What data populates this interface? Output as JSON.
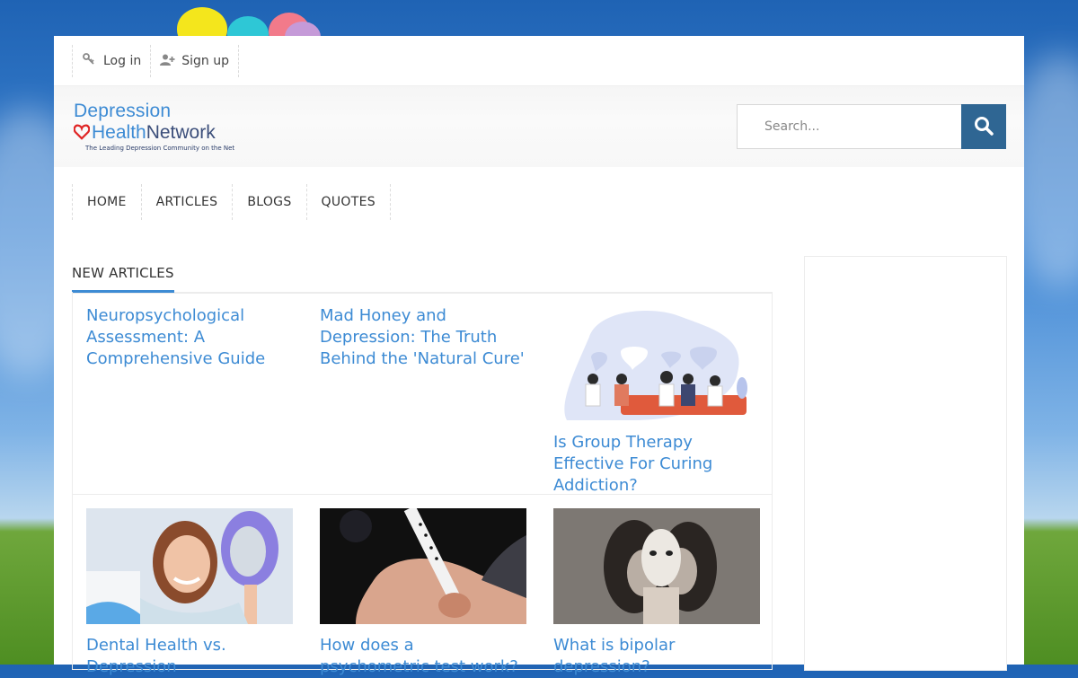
{
  "topbar": {
    "login_label": "Log in",
    "signup_label": "Sign up"
  },
  "logo": {
    "line1": "Depression",
    "line2a": "Health",
    "line2b": "Network",
    "tagline": "The Leading Depression Community on the Net"
  },
  "search": {
    "placeholder": "Search..."
  },
  "nav": {
    "items": [
      "HOME",
      "ARTICLES",
      "BLOGS",
      "QUOTES"
    ]
  },
  "section": {
    "title": "NEW ARTICLES"
  },
  "articles": [
    {
      "title": "Neuropsychological Assessment: A Comprehensive Guide",
      "thumb": "none"
    },
    {
      "title": "Mad Honey and Depression: The Truth Behind the 'Natural Cure'",
      "thumb": "none"
    },
    {
      "title": "Is Group Therapy Effective For Curing Addiction?",
      "thumb": "group-therapy-illustration"
    },
    {
      "title": "Dental Health vs. Depression",
      "thumb": "dentist-photo"
    },
    {
      "title": "How does a psychometric test work?",
      "thumb": "pen-writing-photo"
    },
    {
      "title": "What is bipolar depression?",
      "thumb": "mask-faces-photo"
    }
  ],
  "colors": {
    "accent": "#3d8bd4",
    "search_button": "#2f6693",
    "logo_heart": "#e02626"
  }
}
